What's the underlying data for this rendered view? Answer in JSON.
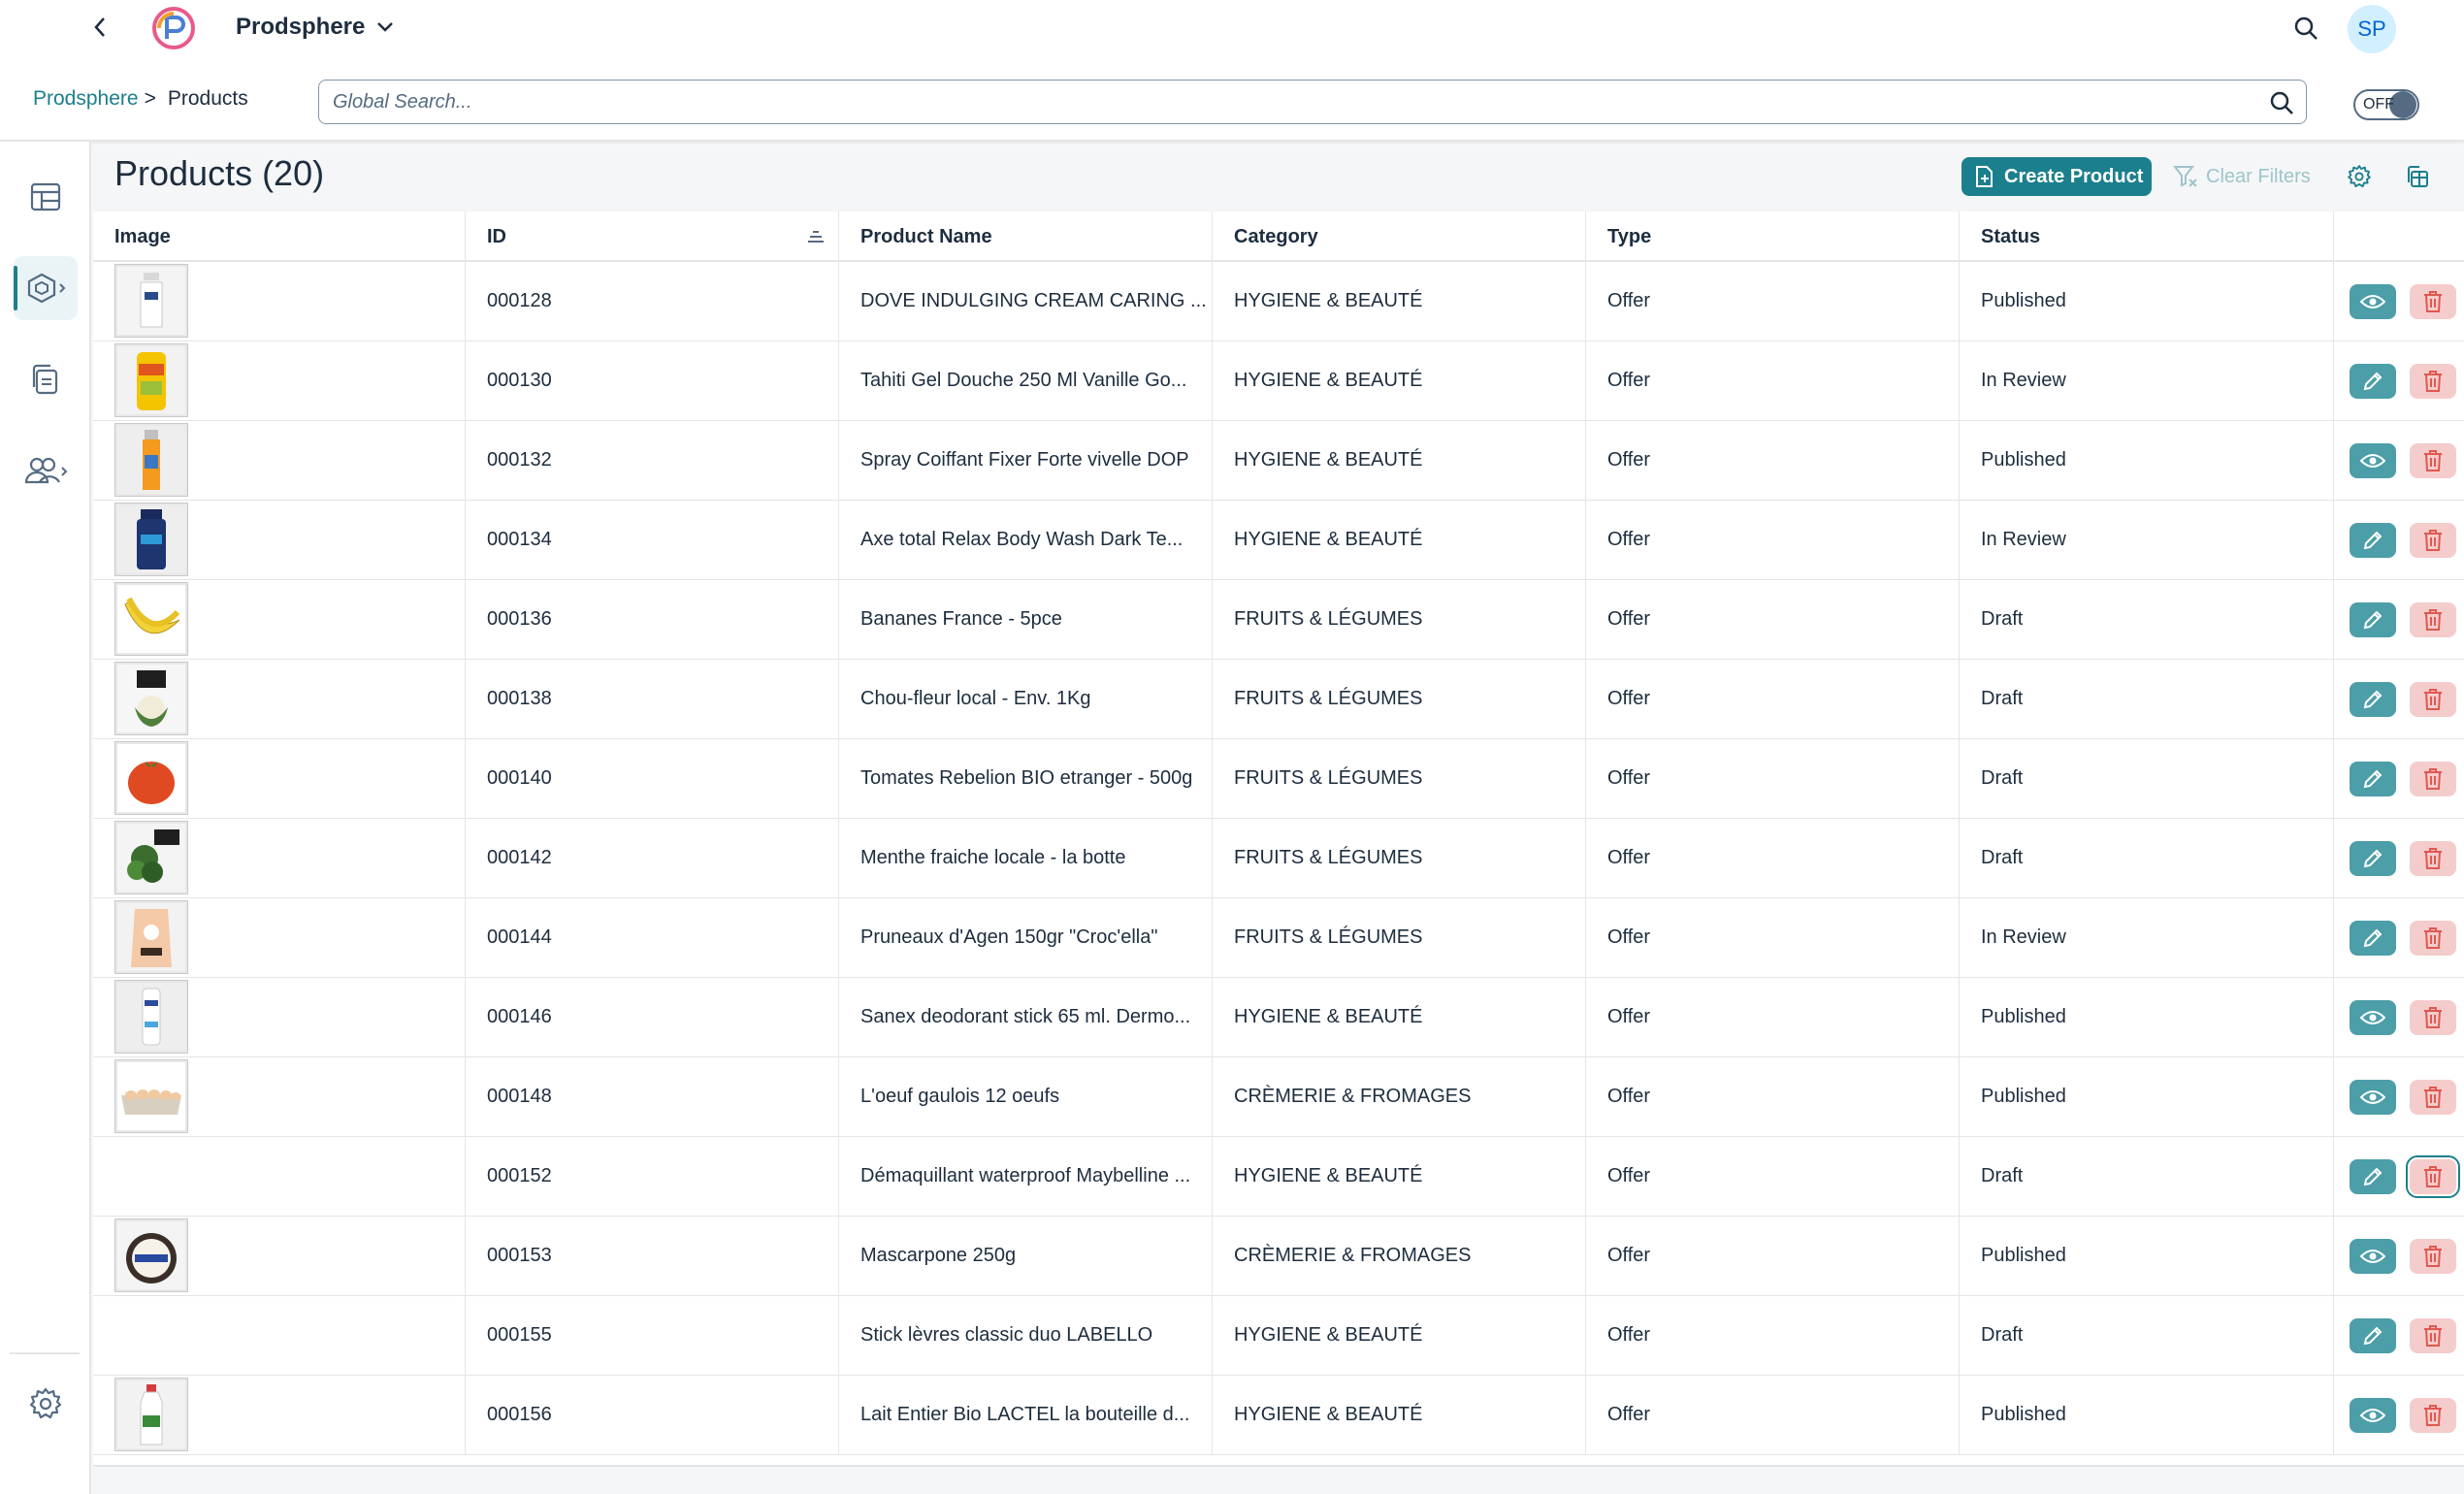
{
  "shell": {
    "app_name": "Prodsphere",
    "avatar_initials": "SP"
  },
  "subheader": {
    "breadcrumb_root": "Prodsphere",
    "breadcrumb_sep": ">",
    "breadcrumb_current": "Products",
    "search_placeholder": "Global Search...",
    "toggle_label": "OFF"
  },
  "toolbar": {
    "title": "Products (20)",
    "create_label": "Create Product",
    "clear_label": "Clear Filters"
  },
  "table": {
    "columns": [
      "Image",
      "ID",
      "Product Name",
      "Category",
      "Type",
      "Status"
    ],
    "rows": [
      {
        "id": "000128",
        "name": "DOVE INDULGING CREAM CARING ...",
        "category": "HYGIENE & BEAUTÉ",
        "type": "Offer",
        "status": "Published",
        "image": "bottle-white",
        "primary_action": "view"
      },
      {
        "id": "000130",
        "name": "Tahiti Gel Douche 250 Ml Vanille Go...",
        "category": "HYGIENE & BEAUTÉ",
        "type": "Offer",
        "status": "In Review",
        "image": "bottle-yellow",
        "primary_action": "edit"
      },
      {
        "id": "000132",
        "name": "Spray Coiffant Fixer Forte vivelle DOP",
        "category": "HYGIENE & BEAUTÉ",
        "type": "Offer",
        "status": "Published",
        "image": "spray-orange",
        "primary_action": "view"
      },
      {
        "id": "000134",
        "name": "Axe total Relax Body Wash Dark Te...",
        "category": "HYGIENE & BEAUTÉ",
        "type": "Offer",
        "status": "In Review",
        "image": "bottle-navy",
        "primary_action": "edit"
      },
      {
        "id": "000136",
        "name": "Bananes France - 5pce",
        "category": "FRUITS & LÉGUMES",
        "type": "Offer",
        "status": "Draft",
        "image": "banana",
        "primary_action": "edit"
      },
      {
        "id": "000138",
        "name": "Chou-fleur local - Env. 1Kg",
        "category": "FRUITS & LÉGUMES",
        "type": "Offer",
        "status": "Draft",
        "image": "cauliflower",
        "primary_action": "edit"
      },
      {
        "id": "000140",
        "name": "Tomates Rebelion BIO etranger - 500g",
        "category": "FRUITS & LÉGUMES",
        "type": "Offer",
        "status": "Draft",
        "image": "tomato",
        "primary_action": "edit"
      },
      {
        "id": "000142",
        "name": "Menthe fraiche locale - la botte",
        "category": "FRUITS & LÉGUMES",
        "type": "Offer",
        "status": "Draft",
        "image": "mint",
        "primary_action": "edit"
      },
      {
        "id": "000144",
        "name": "Pruneaux d'Agen 150gr \"Croc'ella\"",
        "category": "FRUITS & LÉGUMES",
        "type": "Offer",
        "status": "In Review",
        "image": "bag-peach",
        "primary_action": "edit"
      },
      {
        "id": "000146",
        "name": "Sanex deodorant stick 65 ml. Dermo...",
        "category": "HYGIENE & BEAUTÉ",
        "type": "Offer",
        "status": "Published",
        "image": "stick-white",
        "primary_action": "view"
      },
      {
        "id": "000148",
        "name": "L'oeuf gaulois 12 oeufs",
        "category": "CRÈMERIE & FROMAGES",
        "type": "Offer",
        "status": "Published",
        "image": "eggs",
        "primary_action": "view"
      },
      {
        "id": "000152",
        "name": "Démaquillant waterproof Maybelline ...",
        "category": "HYGIENE & BEAUTÉ",
        "type": "Offer",
        "status": "Draft",
        "image": "none",
        "primary_action": "edit"
      },
      {
        "id": "000153",
        "name": "Mascarpone 250g",
        "category": "CRÈMERIE & FROMAGES",
        "type": "Offer",
        "status": "Published",
        "image": "tub",
        "primary_action": "view"
      },
      {
        "id": "000155",
        "name": "Stick lèvres classic duo LABELLO",
        "category": "HYGIENE & BEAUTÉ",
        "type": "Offer",
        "status": "Draft",
        "image": "none",
        "primary_action": "edit"
      },
      {
        "id": "000156",
        "name": "Lait Entier Bio LACTEL la bouteille d...",
        "category": "HYGIENE & BEAUTÉ",
        "type": "Offer",
        "status": "Published",
        "image": "milk",
        "primary_action": "view"
      }
    ]
  },
  "colors": {
    "accent": "#1b7f8d",
    "action_teal": "#4c9ea8",
    "delete_bg": "#f5cccc",
    "delete_icon": "#e0584f"
  }
}
